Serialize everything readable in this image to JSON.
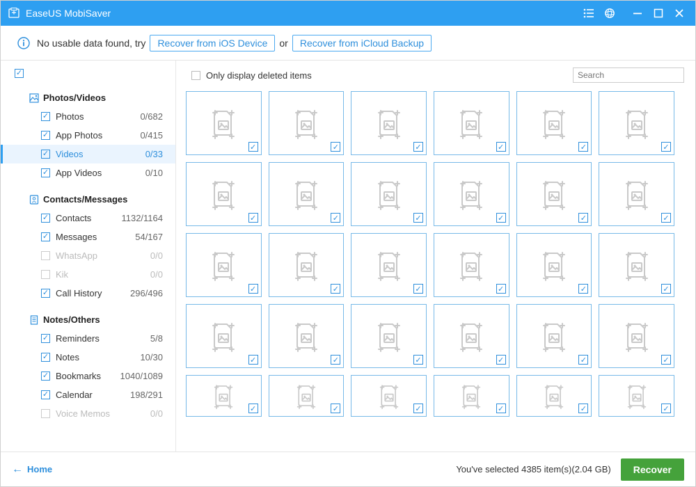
{
  "titlebar": {
    "title": "EaseUS MobiSaver"
  },
  "infobar": {
    "prefix": "No usable data found, try",
    "btn1": "Recover from iOS Device",
    "or": "or",
    "btn2": "Recover from iCloud Backup"
  },
  "sidebar": {
    "groups": [
      {
        "name": "Photos/Videos",
        "icon": "image-icon",
        "items": [
          {
            "label": "Photos",
            "count": "0/682",
            "checked": true,
            "active": false,
            "disabled": false
          },
          {
            "label": "App Photos",
            "count": "0/415",
            "checked": true,
            "active": false,
            "disabled": false
          },
          {
            "label": "Videos",
            "count": "0/33",
            "checked": true,
            "active": true,
            "disabled": false
          },
          {
            "label": "App Videos",
            "count": "0/10",
            "checked": true,
            "active": false,
            "disabled": false
          }
        ]
      },
      {
        "name": "Contacts/Messages",
        "icon": "contact-icon",
        "items": [
          {
            "label": "Contacts",
            "count": "1132/1164",
            "checked": true,
            "active": false,
            "disabled": false
          },
          {
            "label": "Messages",
            "count": "54/167",
            "checked": true,
            "active": false,
            "disabled": false
          },
          {
            "label": "WhatsApp",
            "count": "0/0",
            "checked": false,
            "active": false,
            "disabled": true
          },
          {
            "label": "Kik",
            "count": "0/0",
            "checked": false,
            "active": false,
            "disabled": true
          },
          {
            "label": "Call History",
            "count": "296/496",
            "checked": true,
            "active": false,
            "disabled": false
          }
        ]
      },
      {
        "name": "Notes/Others",
        "icon": "note-icon",
        "items": [
          {
            "label": "Reminders",
            "count": "5/8",
            "checked": true,
            "active": false,
            "disabled": false
          },
          {
            "label": "Notes",
            "count": "10/30",
            "checked": true,
            "active": false,
            "disabled": false
          },
          {
            "label": "Bookmarks",
            "count": "1040/1089",
            "checked": true,
            "active": false,
            "disabled": false
          },
          {
            "label": "Calendar",
            "count": "198/291",
            "checked": true,
            "active": false,
            "disabled": false
          },
          {
            "label": "Voice Memos",
            "count": "0/0",
            "checked": false,
            "active": false,
            "disabled": true
          }
        ]
      }
    ]
  },
  "toolbar": {
    "only_deleted_label": "Only display deleted items",
    "search_placeholder": "Search"
  },
  "grid": {
    "full_rows": 4,
    "short_rows": 1,
    "cols": 6
  },
  "footer": {
    "home": "Home",
    "status": "You've selected 4385 item(s)(2.04 GB)",
    "recover": "Recover"
  }
}
